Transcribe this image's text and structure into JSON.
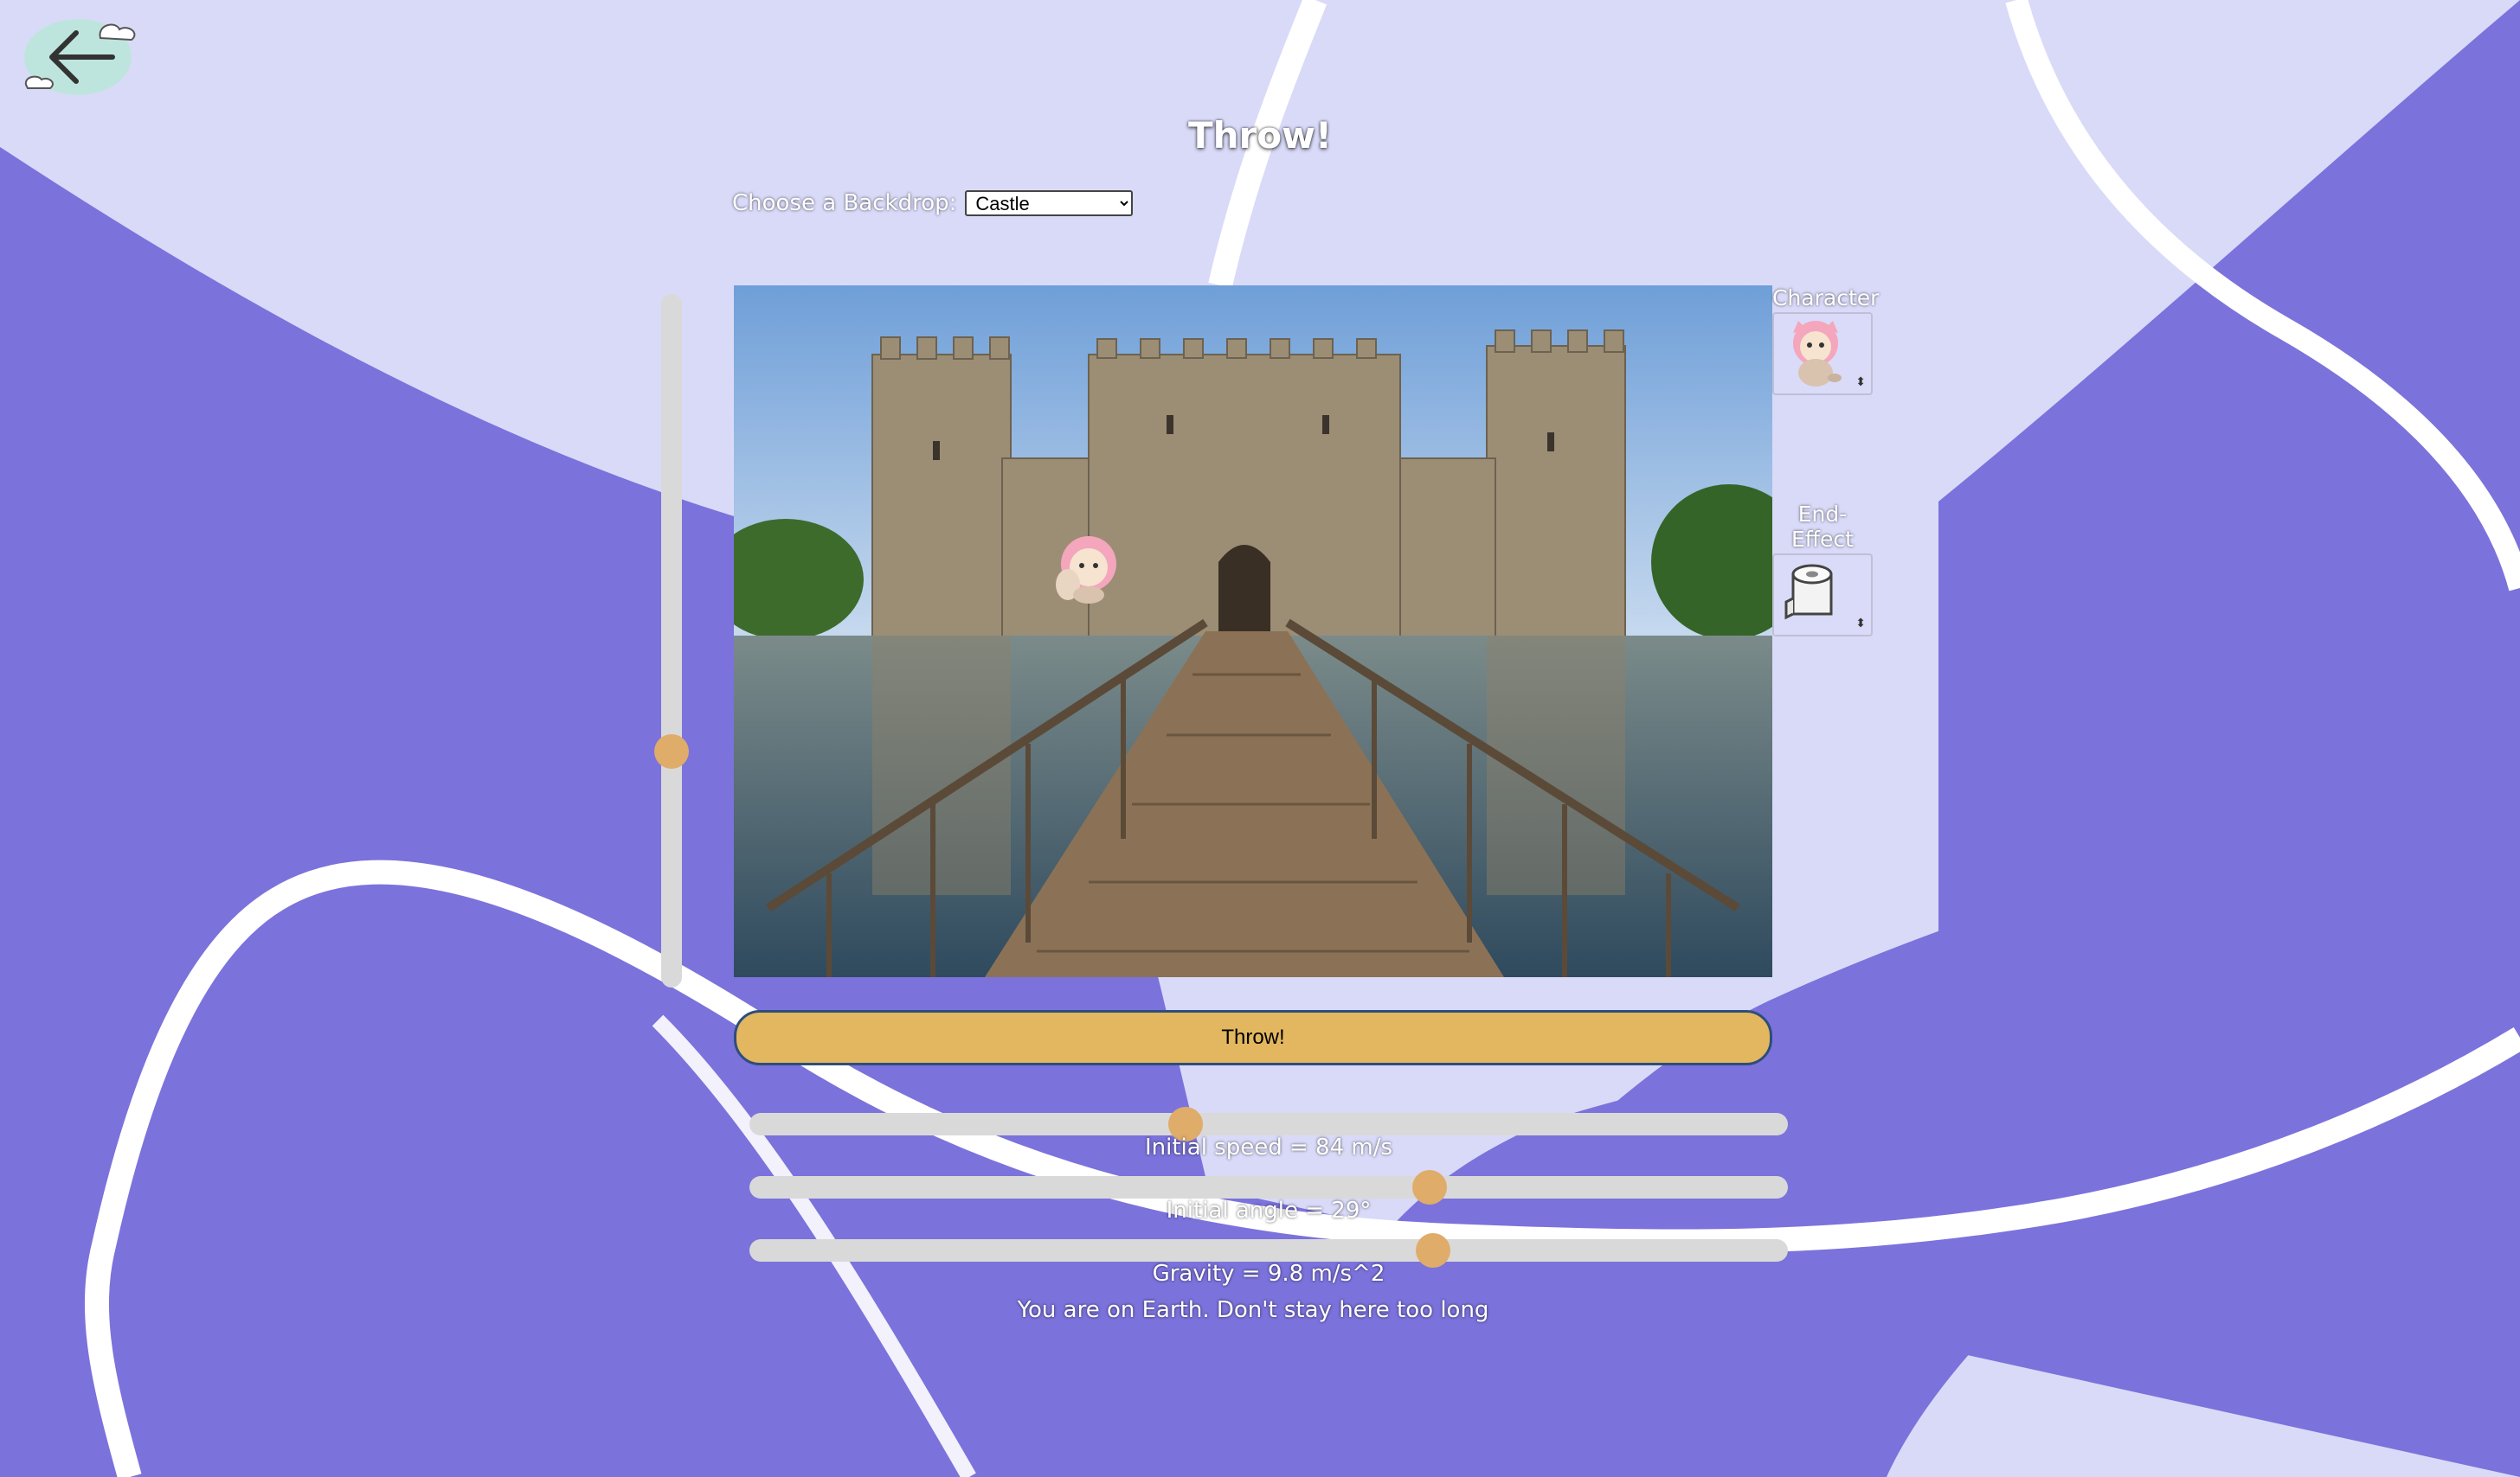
{
  "page": {
    "title": "Throw!"
  },
  "backdrop": {
    "label": "Choose a Backdrop:",
    "selected": "Castle"
  },
  "sidebar": {
    "character_label": "Character",
    "end_effect_label": "End-Effect"
  },
  "vertical_slider": {
    "value": 0.34
  },
  "throw_button": {
    "label": "Throw!"
  },
  "sliders": [
    {
      "label": "Initial speed = 84 m/s",
      "value": 0.42
    },
    {
      "label": "Initial angle = 29°",
      "value": 0.655
    },
    {
      "label": "Gravity = 9.8 m/s^2",
      "value": 0.658
    }
  ],
  "message": "You are on Earth. Don't stay here too long",
  "colors": {
    "background": "#d9daf8",
    "purple_band": "#7b72dc",
    "slider_thumb": "#dfac6a",
    "button_fill": "#e2b75f",
    "button_border": "#2d4e7c"
  },
  "icons": [
    "back-arrow-icon",
    "cloud-icon",
    "cat-character-icon",
    "toilet-paper-icon"
  ]
}
